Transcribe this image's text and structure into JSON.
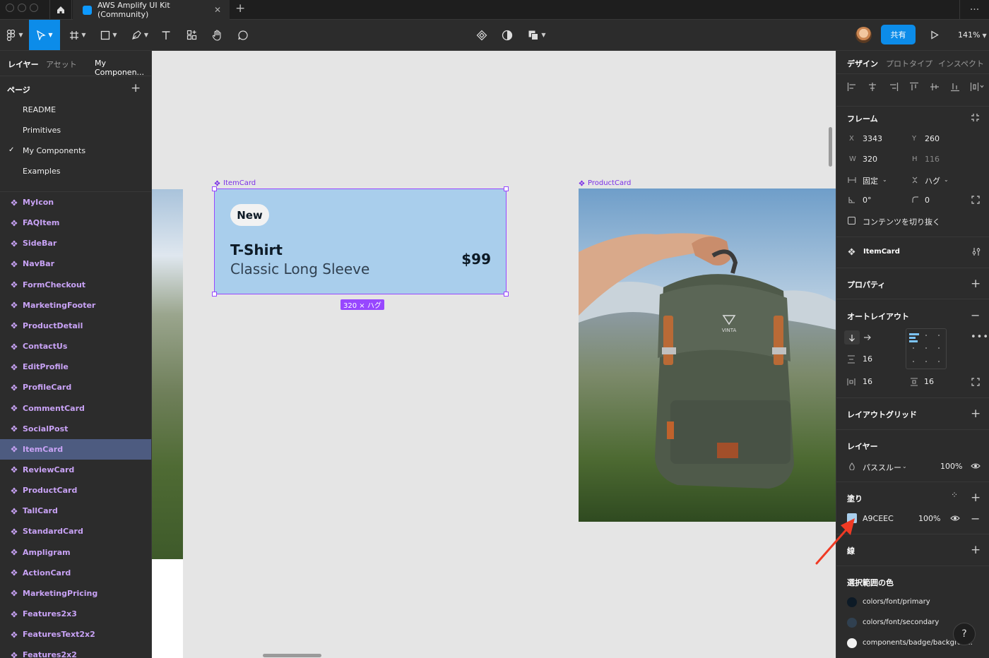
{
  "window": {
    "tab_title": "AWS Amplify UI Kit (Community)",
    "close_glyph": "✕",
    "new_tab_glyph": "+",
    "more_glyph": "···"
  },
  "toolbar": {
    "share_label": "共有",
    "zoom": "141%"
  },
  "left_panel": {
    "tabs": [
      "レイヤー",
      "アセット",
      "My Componen..."
    ],
    "pages_header": "ページ",
    "pages": [
      {
        "label": "README",
        "selected": false
      },
      {
        "label": "Primitives",
        "selected": false
      },
      {
        "label": "My Components",
        "selected": true
      },
      {
        "label": "Examples",
        "selected": false
      }
    ],
    "layers": [
      {
        "label": "MyIcon",
        "selected": false
      },
      {
        "label": "FAQItem",
        "selected": false
      },
      {
        "label": "SideBar",
        "selected": false
      },
      {
        "label": "NavBar",
        "selected": false
      },
      {
        "label": "FormCheckout",
        "selected": false
      },
      {
        "label": "MarketingFooter",
        "selected": false
      },
      {
        "label": "ProductDetail",
        "selected": false
      },
      {
        "label": "ContactUs",
        "selected": false
      },
      {
        "label": "EditProfile",
        "selected": false
      },
      {
        "label": "ProfileCard",
        "selected": false
      },
      {
        "label": "CommentCard",
        "selected": false
      },
      {
        "label": "SocialPost",
        "selected": false
      },
      {
        "label": "ItemCard",
        "selected": true
      },
      {
        "label": "ReviewCard",
        "selected": false
      },
      {
        "label": "ProductCard",
        "selected": false
      },
      {
        "label": "TallCard",
        "selected": false
      },
      {
        "label": "StandardCard",
        "selected": false
      },
      {
        "label": "Ampligram",
        "selected": false
      },
      {
        "label": "ActionCard",
        "selected": false
      },
      {
        "label": "MarketingPricing",
        "selected": false
      },
      {
        "label": "Features2x3",
        "selected": false
      },
      {
        "label": "FeaturesText2x2",
        "selected": false
      },
      {
        "label": "Features2x2",
        "selected": false
      }
    ]
  },
  "canvas": {
    "item_card_label": "ItemCard",
    "product_card_label": "ProductCard",
    "card": {
      "badge": "New",
      "title": "T-Shirt",
      "subtitle": "Classic Long Sleeve",
      "price": "$99",
      "background": "#A9CEEC"
    },
    "size_tag": "320 × ハグ",
    "backpack_brand": "VINTA"
  },
  "right_panel": {
    "tabs": [
      "デザイン",
      "プロトタイプ",
      "インスペクト"
    ],
    "frame": {
      "header": "フレーム",
      "x_label": "X",
      "x": "3343",
      "y_label": "Y",
      "y": "260",
      "w_label": "W",
      "w": "320",
      "h_label": "H",
      "h": "116",
      "width_mode": "固定",
      "height_mode": "ハグ",
      "rotation": "0°",
      "radius": "0",
      "clip_label": "コンテンツを切り抜く"
    },
    "component_name": "ItemCard",
    "properties_header": "プロパティ",
    "autolayout": {
      "header": "オートレイアウト",
      "gap": "16",
      "padding_h": "16",
      "padding_v": "16"
    },
    "layout_grid_header": "レイアウトグリッド",
    "layer": {
      "header": "レイヤー",
      "blend": "パススルー",
      "opacity": "100%"
    },
    "fill": {
      "header": "塗り",
      "hex": "A9CEEC",
      "opacity": "100%",
      "color": "#A9CEEC"
    },
    "stroke_header": "線",
    "selection_colors": {
      "header": "選択範囲の色",
      "items": [
        {
          "label": "colors/font/primary",
          "color": "#0D1A26"
        },
        {
          "label": "colors/font/secondary",
          "color": "#304050"
        },
        {
          "label": "components/badge/backgrou...",
          "color": "#F2F2F2"
        }
      ]
    },
    "help": "?"
  },
  "colors": {
    "accent": "#0C8CE9",
    "component_purple": "#9747FF",
    "annotation_arrow": "#F03A24"
  }
}
